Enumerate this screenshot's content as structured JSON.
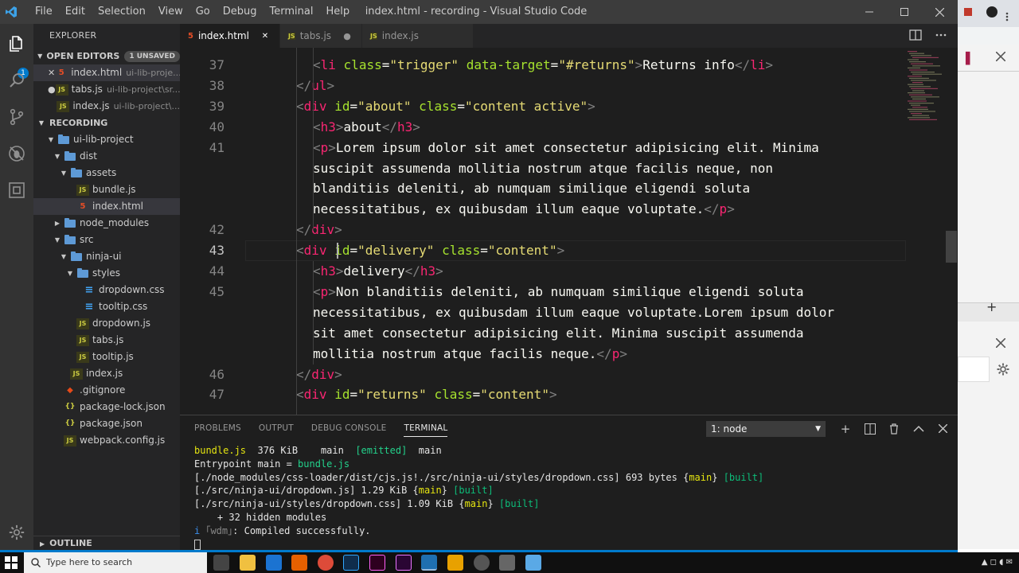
{
  "window": {
    "title": "index.html - recording - Visual Studio Code",
    "menu": [
      "File",
      "Edit",
      "Selection",
      "View",
      "Go",
      "Debug",
      "Terminal",
      "Help"
    ]
  },
  "activity": {
    "badge": "1"
  },
  "sidebar": {
    "title": "EXPLORER",
    "open_editors": {
      "label": "OPEN EDITORS",
      "badge": "1 UNSAVED",
      "items": [
        {
          "name": "index.html",
          "path": "ui-lib-proje...",
          "state": "close"
        },
        {
          "name": "tabs.js",
          "path": "ui-lib-project\\sr...",
          "state": "dirty"
        },
        {
          "name": "index.js",
          "path": "ui-lib-project\\...",
          "state": "none"
        }
      ]
    },
    "project": {
      "label": "RECORDING",
      "tree": [
        {
          "label": "ui-lib-project",
          "depth": 1,
          "type": "folder",
          "open": true
        },
        {
          "label": "dist",
          "depth": 2,
          "type": "folder",
          "open": true
        },
        {
          "label": "assets",
          "depth": 3,
          "type": "folder",
          "open": true
        },
        {
          "label": "bundle.js",
          "depth": 4,
          "type": "js"
        },
        {
          "label": "index.html",
          "depth": 4,
          "type": "html",
          "selected": true
        },
        {
          "label": "node_modules",
          "depth": 2,
          "type": "folder",
          "open": false
        },
        {
          "label": "src",
          "depth": 2,
          "type": "folder",
          "open": true
        },
        {
          "label": "ninja-ui",
          "depth": 3,
          "type": "folder",
          "open": true
        },
        {
          "label": "styles",
          "depth": 4,
          "type": "folder",
          "open": true
        },
        {
          "label": "dropdown.css",
          "depth": 5,
          "type": "css"
        },
        {
          "label": "tooltip.css",
          "depth": 5,
          "type": "css"
        },
        {
          "label": "dropdown.js",
          "depth": 4,
          "type": "js"
        },
        {
          "label": "tabs.js",
          "depth": 4,
          "type": "js"
        },
        {
          "label": "tooltip.js",
          "depth": 4,
          "type": "js"
        },
        {
          "label": "index.js",
          "depth": 3,
          "type": "js"
        },
        {
          "label": ".gitignore",
          "depth": 2,
          "type": "git"
        },
        {
          "label": "package-lock.json",
          "depth": 2,
          "type": "json"
        },
        {
          "label": "package.json",
          "depth": 2,
          "type": "json"
        },
        {
          "label": "webpack.config.js",
          "depth": 2,
          "type": "js"
        }
      ]
    },
    "outline": "OUTLINE"
  },
  "tabs": [
    {
      "label": "index.html",
      "type": "html",
      "active": true,
      "marker": "×"
    },
    {
      "label": "tabs.js",
      "type": "js",
      "active": false,
      "marker": "●"
    },
    {
      "label": "index.js",
      "type": "js",
      "active": false,
      "marker": ""
    }
  ],
  "editor": {
    "current_line": "43",
    "lines": [
      {
        "n": "37",
        "indent": 2,
        "tokens": [
          [
            "p",
            "<"
          ],
          [
            "g",
            "li"
          ],
          [
            "e",
            " "
          ],
          [
            "a",
            "class"
          ],
          [
            "e",
            "="
          ],
          [
            "s",
            "\"trigger\""
          ],
          [
            "e",
            " "
          ],
          [
            "a",
            "data-target"
          ],
          [
            "e",
            "="
          ],
          [
            "s",
            "\"#returns\""
          ],
          [
            "p",
            ">"
          ],
          [
            "t",
            "Returns info"
          ],
          [
            "p",
            "</"
          ],
          [
            "g",
            "li"
          ],
          [
            "p",
            ">"
          ]
        ]
      },
      {
        "n": "38",
        "indent": 1,
        "tokens": [
          [
            "p",
            "</"
          ],
          [
            "g",
            "ul"
          ],
          [
            "p",
            ">"
          ]
        ]
      },
      {
        "n": "39",
        "indent": 1,
        "tokens": [
          [
            "p",
            "<"
          ],
          [
            "g",
            "div"
          ],
          [
            "e",
            " "
          ],
          [
            "a",
            "id"
          ],
          [
            "e",
            "="
          ],
          [
            "s",
            "\"about\""
          ],
          [
            "e",
            " "
          ],
          [
            "a",
            "class"
          ],
          [
            "e",
            "="
          ],
          [
            "s",
            "\"content active\""
          ],
          [
            "p",
            ">"
          ]
        ]
      },
      {
        "n": "40",
        "indent": 2,
        "tokens": [
          [
            "p",
            "<"
          ],
          [
            "g",
            "h3"
          ],
          [
            "p",
            ">"
          ],
          [
            "t",
            "about"
          ],
          [
            "p",
            "</"
          ],
          [
            "g",
            "h3"
          ],
          [
            "p",
            ">"
          ]
        ]
      },
      {
        "n": "41",
        "indent": 2,
        "tokens": [
          [
            "p",
            "<"
          ],
          [
            "g",
            "p"
          ],
          [
            "p",
            ">"
          ],
          [
            "t",
            "Lorem ipsum dolor sit amet consectetur adipisicing elit. Minima"
          ]
        ]
      },
      {
        "n": "",
        "indent": 2,
        "tokens": [
          [
            "t",
            "suscipit assumenda mollitia nostrum atque facilis neque, non"
          ]
        ]
      },
      {
        "n": "",
        "indent": 2,
        "tokens": [
          [
            "t",
            "blanditiis deleniti, ab numquam similique eligendi soluta"
          ]
        ]
      },
      {
        "n": "",
        "indent": 2,
        "tokens": [
          [
            "t",
            "necessitatibus, ex quibusdam illum eaque voluptate."
          ],
          [
            "p",
            "</"
          ],
          [
            "g",
            "p"
          ],
          [
            "p",
            ">"
          ]
        ]
      },
      {
        "n": "42",
        "indent": 1,
        "tokens": [
          [
            "p",
            "</"
          ],
          [
            "g",
            "div"
          ],
          [
            "p",
            ">"
          ]
        ]
      },
      {
        "n": "43",
        "indent": 1,
        "tokens": [
          [
            "p",
            "<"
          ],
          [
            "g",
            "div"
          ],
          [
            "e",
            " "
          ],
          [
            "a",
            "id"
          ],
          [
            "e",
            "="
          ],
          [
            "s",
            "\"delivery\""
          ],
          [
            "e",
            " "
          ],
          [
            "a",
            "class"
          ],
          [
            "e",
            "="
          ],
          [
            "s",
            "\"content\""
          ],
          [
            "p",
            ">"
          ]
        ]
      },
      {
        "n": "44",
        "indent": 2,
        "tokens": [
          [
            "p",
            "<"
          ],
          [
            "g",
            "h3"
          ],
          [
            "p",
            ">"
          ],
          [
            "t",
            "delivery"
          ],
          [
            "p",
            "</"
          ],
          [
            "g",
            "h3"
          ],
          [
            "p",
            ">"
          ]
        ]
      },
      {
        "n": "45",
        "indent": 2,
        "tokens": [
          [
            "p",
            "<"
          ],
          [
            "g",
            "p"
          ],
          [
            "p",
            ">"
          ],
          [
            "t",
            "Non blanditiis deleniti, ab numquam similique eligendi soluta"
          ]
        ]
      },
      {
        "n": "",
        "indent": 2,
        "tokens": [
          [
            "t",
            "necessitatibus, ex quibusdam illum eaque voluptate.Lorem ipsum dolor"
          ]
        ]
      },
      {
        "n": "",
        "indent": 2,
        "tokens": [
          [
            "t",
            "sit amet consectetur adipisicing elit. Minima suscipit assumenda"
          ]
        ]
      },
      {
        "n": "",
        "indent": 2,
        "tokens": [
          [
            "t",
            "mollitia nostrum atque facilis neque."
          ],
          [
            "p",
            "</"
          ],
          [
            "g",
            "p"
          ],
          [
            "p",
            ">"
          ]
        ]
      },
      {
        "n": "46",
        "indent": 1,
        "tokens": [
          [
            "p",
            "</"
          ],
          [
            "g",
            "div"
          ],
          [
            "p",
            ">"
          ]
        ]
      },
      {
        "n": "47",
        "indent": 1,
        "tokens": [
          [
            "p",
            "<"
          ],
          [
            "g",
            "div"
          ],
          [
            "e",
            " "
          ],
          [
            "a",
            "id"
          ],
          [
            "e",
            "="
          ],
          [
            "s",
            "\"returns\""
          ],
          [
            "e",
            " "
          ],
          [
            "a",
            "class"
          ],
          [
            "e",
            "="
          ],
          [
            "s",
            "\"content\""
          ],
          [
            "p",
            ">"
          ]
        ]
      }
    ]
  },
  "panel": {
    "tabs": [
      "PROBLEMS",
      "OUTPUT",
      "DEBUG CONSOLE",
      "TERMINAL"
    ],
    "active_tab": "TERMINAL",
    "terminal_select": "1: node",
    "terminal_lines": [
      [
        [
          "y",
          "bundle.js"
        ],
        [
          "w",
          "  376 KiB    main  "
        ],
        [
          "g",
          "[emitted]"
        ],
        [
          "w",
          "  main"
        ]
      ],
      [
        [
          "w",
          "Entrypoint main = "
        ],
        [
          "g",
          "bundle.js"
        ]
      ],
      [
        [
          "w",
          "[./node_modules/css-loader/dist/cjs.js!./src/ninja-ui/styles/dropdown.css] 693 bytes {"
        ],
        [
          "y",
          "main"
        ],
        [
          "w",
          "} "
        ],
        [
          "gd",
          "[built]"
        ]
      ],
      [
        [
          "w",
          "[./src/ninja-ui/dropdown.js] 1.29 KiB {"
        ],
        [
          "y",
          "main"
        ],
        [
          "w",
          "} "
        ],
        [
          "gd",
          "[built]"
        ]
      ],
      [
        [
          "w",
          "[./src/ninja-ui/styles/dropdown.css] 1.09 KiB {"
        ],
        [
          "y",
          "main"
        ],
        [
          "w",
          "} "
        ],
        [
          "gd",
          "[built]"
        ]
      ],
      [
        [
          "w",
          "    + 32 hidden modules"
        ]
      ],
      [
        [
          "b",
          "i"
        ],
        [
          "gr",
          " ｢wdm｣"
        ],
        [
          "w",
          ": Compiled successfully."
        ]
      ]
    ]
  },
  "taskbar": {
    "search_placeholder": "Type here to search"
  },
  "colors": {
    "accent": "#007acc",
    "tag": "#f92672",
    "attr": "#a6e22e",
    "string": "#e6db74"
  }
}
